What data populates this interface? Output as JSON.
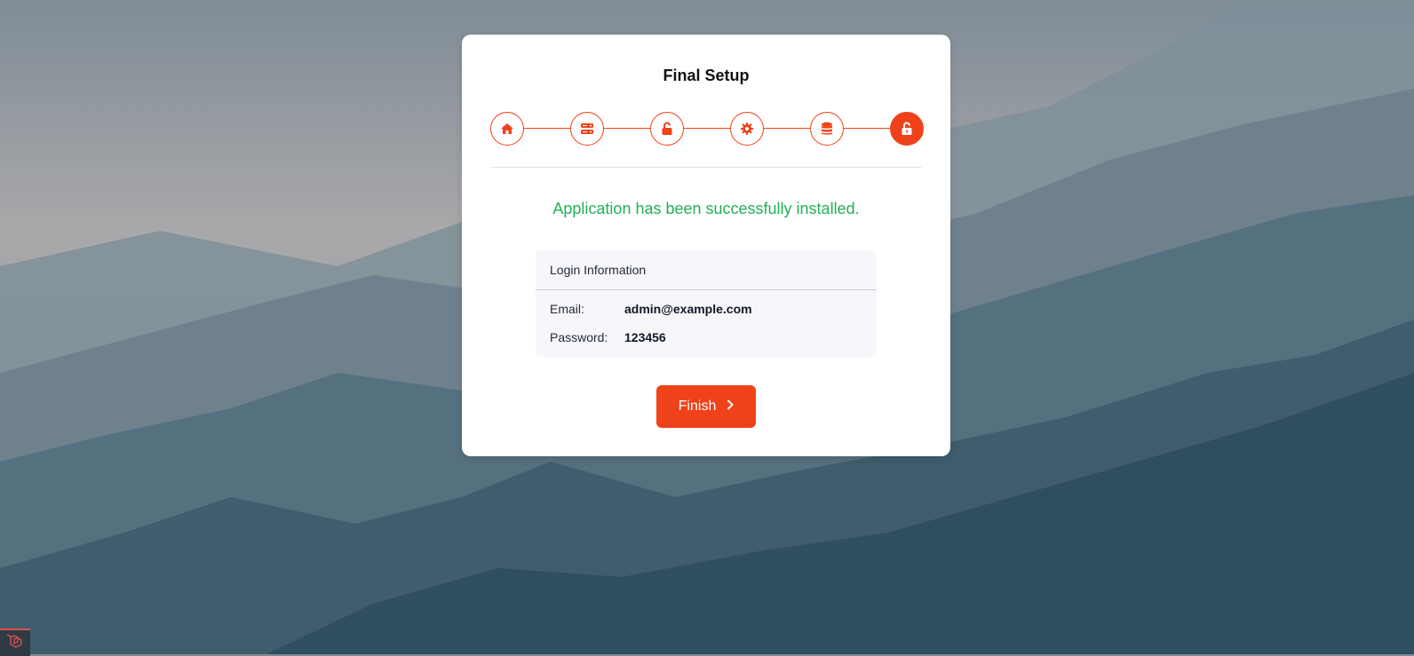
{
  "page": {
    "title": "Final Setup",
    "success_message": "Application has been successfully installed."
  },
  "steps": [
    {
      "icon": "home-icon",
      "state": "done"
    },
    {
      "icon": "server-icon",
      "state": "done"
    },
    {
      "icon": "unlock-icon",
      "state": "done"
    },
    {
      "icon": "gear-icon",
      "state": "done"
    },
    {
      "icon": "database-icon",
      "state": "done"
    },
    {
      "icon": "unlock-icon",
      "state": "active"
    }
  ],
  "login_info": {
    "heading": "Login Information",
    "email_label": "Email:",
    "email_value": "admin@example.com",
    "password_label": "Password:",
    "password_value": "123456"
  },
  "actions": {
    "finish_label": "Finish"
  },
  "colors": {
    "accent": "#f0421a",
    "success": "#22b157"
  }
}
